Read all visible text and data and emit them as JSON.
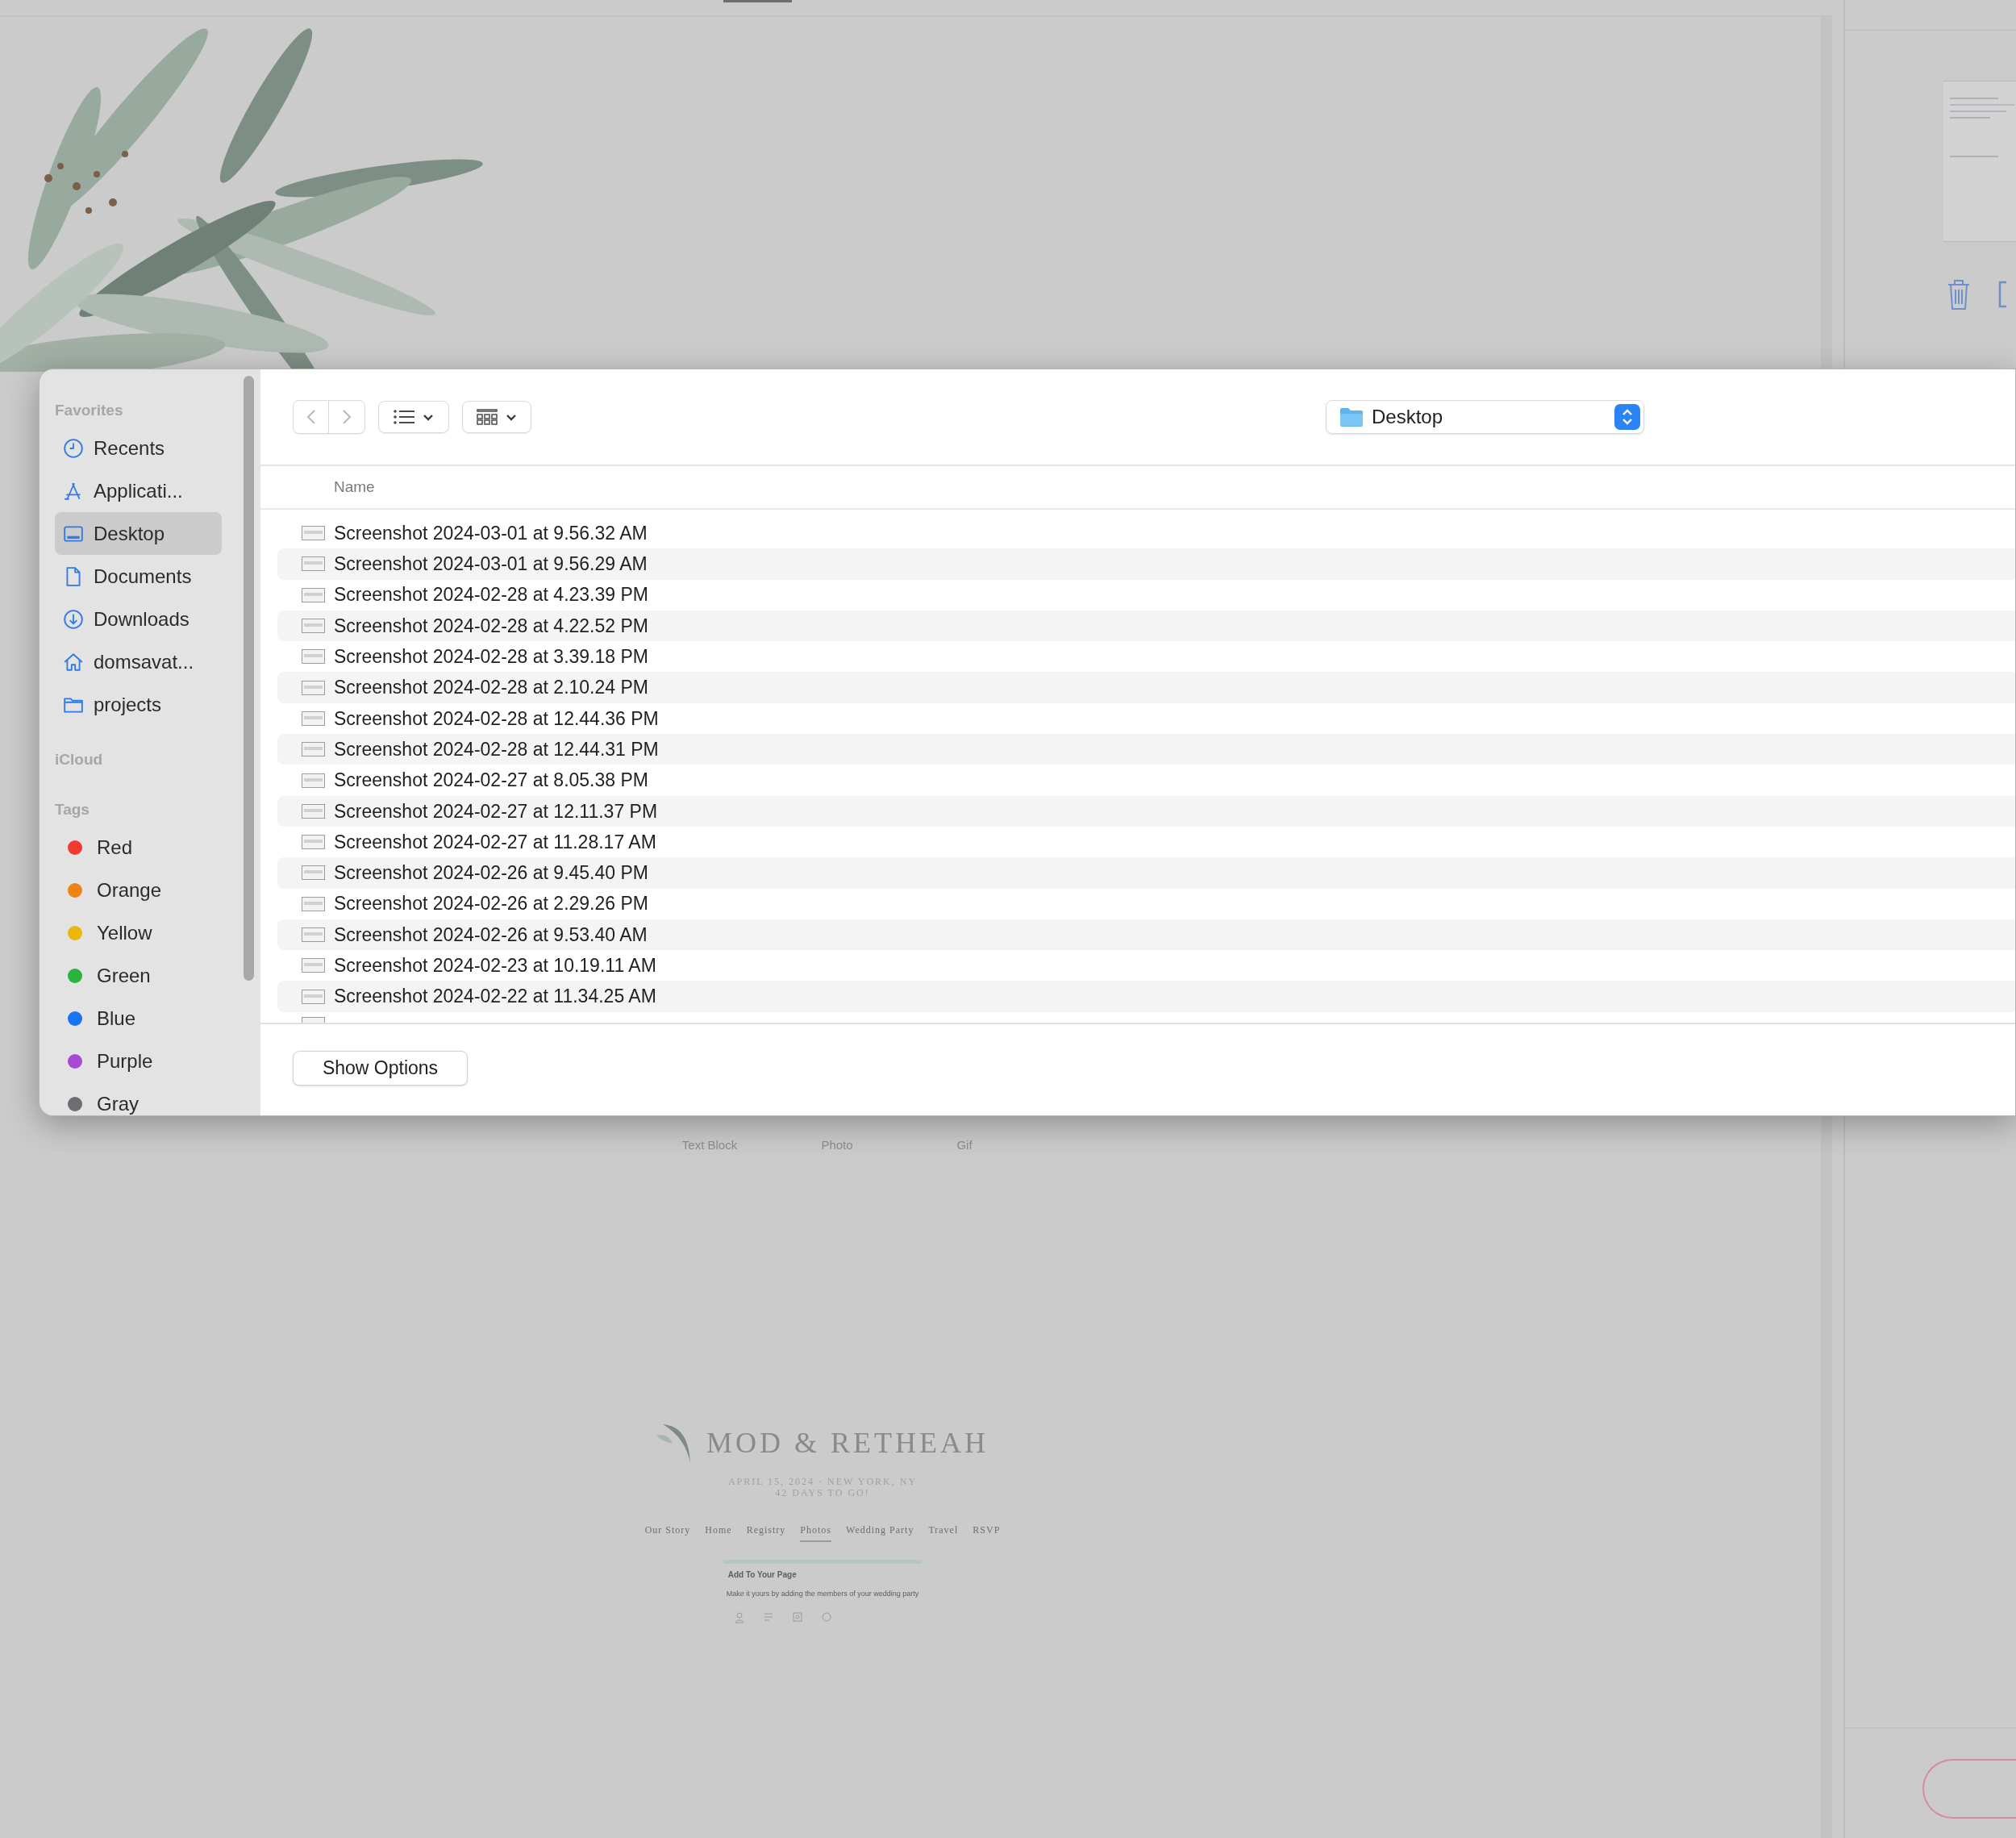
{
  "background_page": {
    "block_labels": [
      "Text Block",
      "Photo",
      "Gif"
    ],
    "preview": {
      "title": "MOD & RETHEAH",
      "date_line": "APRIL 15, 2024 · NEW YORK, NY",
      "countdown": "42 DAYS TO GO!",
      "nav": [
        {
          "label": "Our Story",
          "selected": false
        },
        {
          "label": "Home",
          "selected": false
        },
        {
          "label": "Registry",
          "selected": false
        },
        {
          "label": "Photos",
          "selected": true
        },
        {
          "label": "Wedding Party",
          "selected": false
        },
        {
          "label": "Travel",
          "selected": false
        },
        {
          "label": "RSVP",
          "selected": false
        }
      ],
      "card_title": "Add To Your Page",
      "card_text": "Make it yours by adding the members of your wedding party"
    }
  },
  "dialog": {
    "sidebar": {
      "favorites_title": "Favorites",
      "favorites": [
        {
          "label": "Recents",
          "selected": false
        },
        {
          "label": "Applicati...",
          "selected": false
        },
        {
          "label": "Desktop",
          "selected": true
        },
        {
          "label": "Documents",
          "selected": false
        },
        {
          "label": "Downloads",
          "selected": false
        },
        {
          "label": "domsavat...",
          "selected": false
        },
        {
          "label": "projects",
          "selected": false
        }
      ],
      "icloud_title": "iCloud",
      "tags_title": "Tags",
      "tags": [
        {
          "label": "Red",
          "color": "#f23b30"
        },
        {
          "label": "Orange",
          "color": "#ee8316"
        },
        {
          "label": "Yellow",
          "color": "#e9b70e"
        },
        {
          "label": "Green",
          "color": "#2ab43f"
        },
        {
          "label": "Blue",
          "color": "#1874f2"
        },
        {
          "label": "Purple",
          "color": "#a54bd3"
        },
        {
          "label": "Gray",
          "color": "#6d6d72"
        }
      ]
    },
    "location": "Desktop",
    "column_header": "Name",
    "files": [
      "Screenshot 2024-03-01 at 9.56.32 AM",
      "Screenshot 2024-03-01 at 9.56.29 AM",
      "Screenshot 2024-02-28 at 4.23.39 PM",
      "Screenshot 2024-02-28 at 4.22.52 PM",
      "Screenshot 2024-02-28 at 3.39.18 PM",
      "Screenshot 2024-02-28 at 2.10.24 PM",
      "Screenshot 2024-02-28 at 12.44.36 PM",
      "Screenshot 2024-02-28 at 12.44.31 PM",
      "Screenshot 2024-02-27 at 8.05.38 PM",
      "Screenshot 2024-02-27 at 12.11.37 PM",
      "Screenshot 2024-02-27 at 11.28.17 AM",
      "Screenshot 2024-02-26 at 9.45.40 PM",
      "Screenshot 2024-02-26 at 2.29.26 PM",
      "Screenshot 2024-02-26 at 9.53.40 AM",
      "Screenshot 2024-02-23 at 10.19.11 AM",
      "Screenshot 2024-02-22 at 11.34.25 AM"
    ],
    "options_button": "Show Options"
  }
}
